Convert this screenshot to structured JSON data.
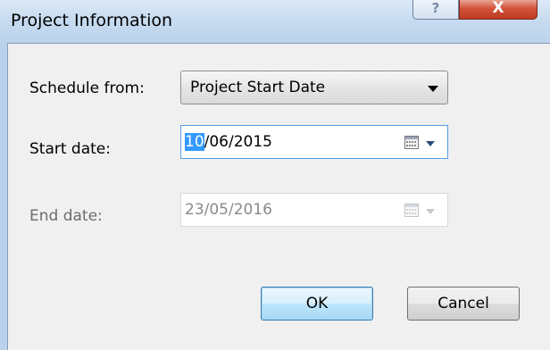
{
  "window": {
    "title": "Project Information",
    "help_glyph": "?",
    "close_glyph": "X"
  },
  "form": {
    "schedule_from_label": "Schedule from:",
    "schedule_from_value": "Project Start Date",
    "start_date_label": "Start date:",
    "start_date_selected": "10",
    "start_date_rest": "/06/2015",
    "end_date_label": "End date:",
    "end_date_value": "23/05/2016"
  },
  "buttons": {
    "ok_label": "OK",
    "cancel_label": "Cancel"
  },
  "colors": {
    "selection": "#3399ff",
    "focus_border": "#569de5",
    "disabled_text": "#8a8a8a"
  },
  "icons": {
    "help": "help-icon",
    "close": "close-icon",
    "calendar": "calendar-icon",
    "dropdown_arrow": "chevron-down-icon"
  }
}
